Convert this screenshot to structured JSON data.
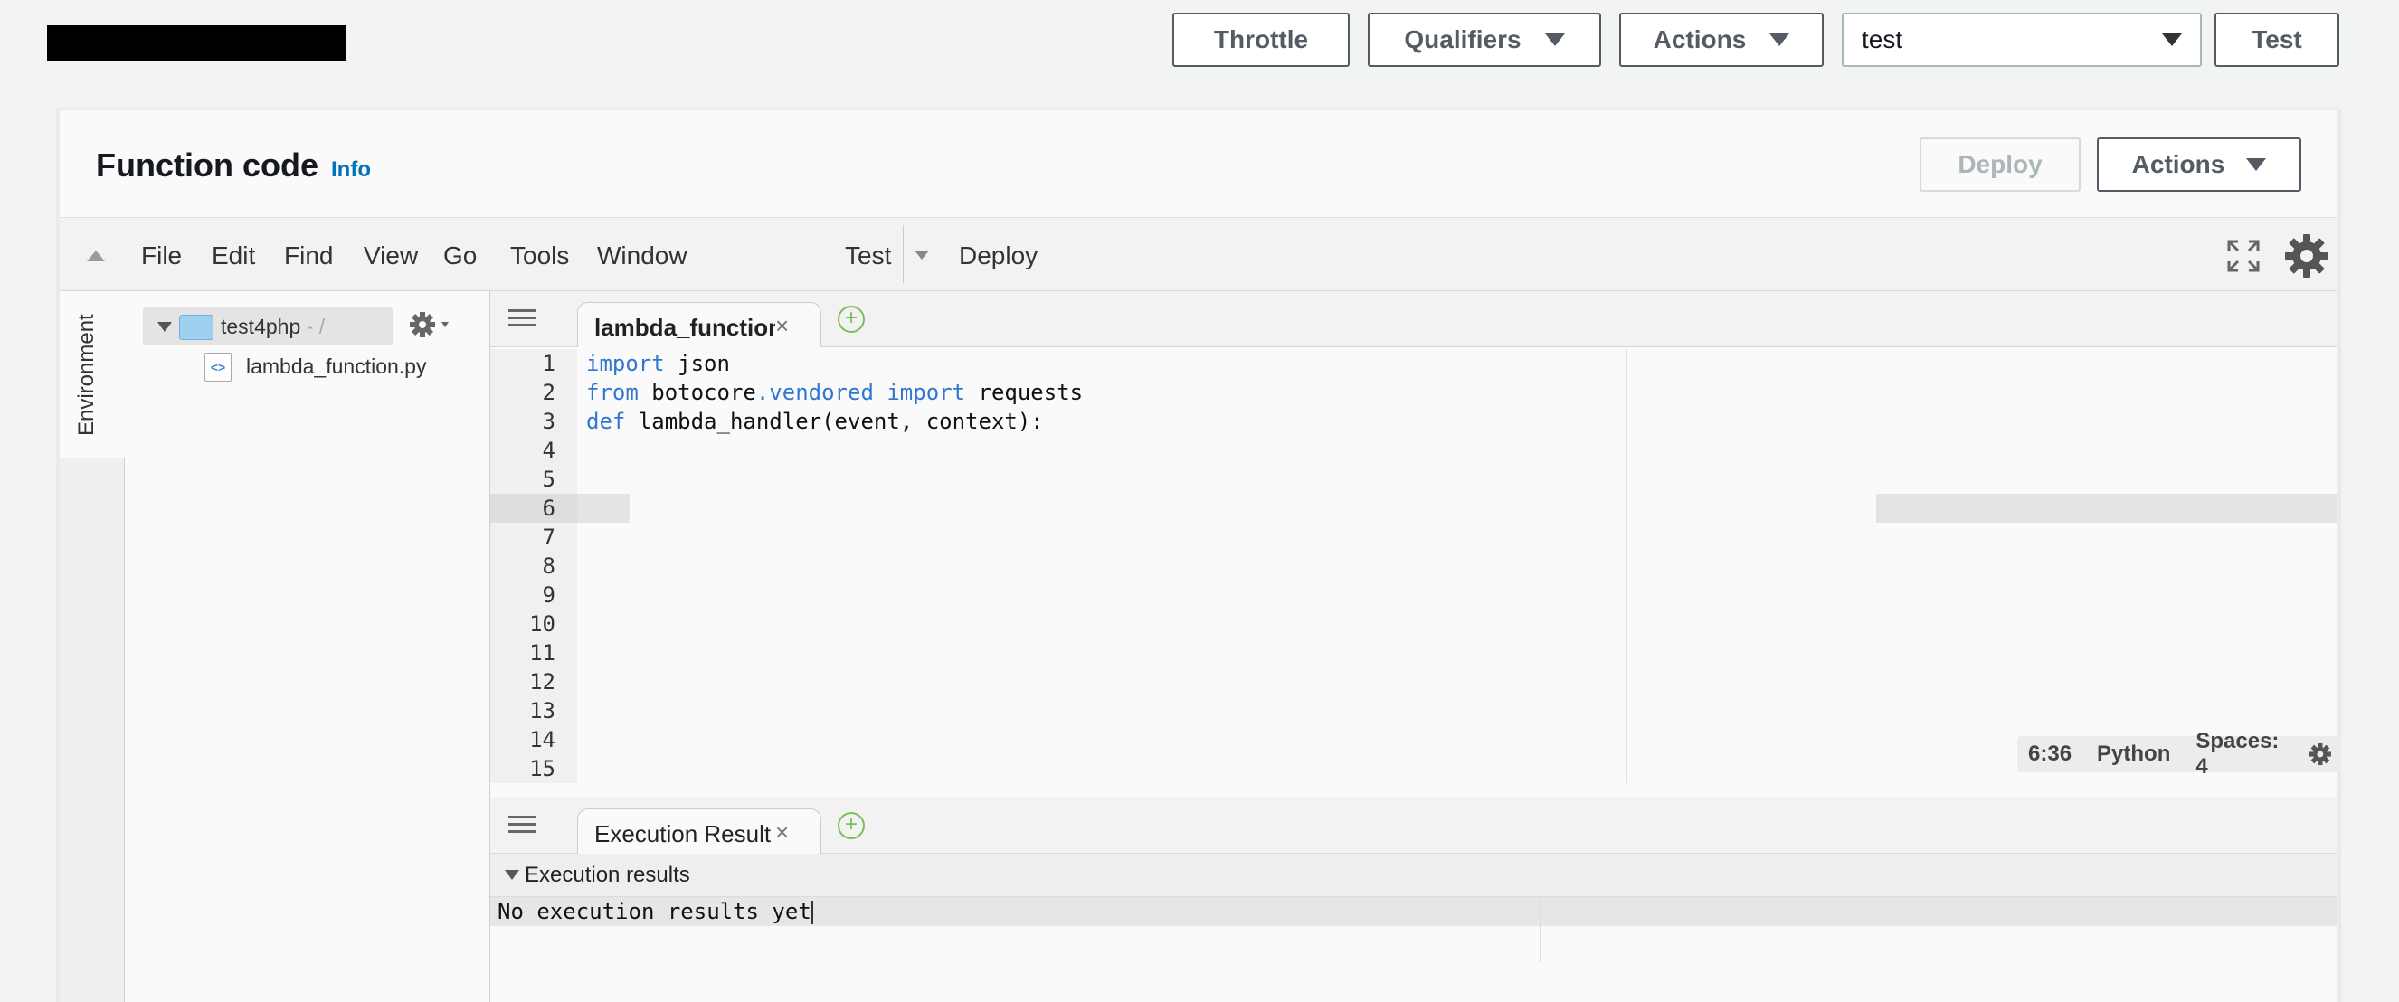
{
  "topbar": {
    "throttle_label": "Throttle",
    "qualifiers_label": "Qualifiers",
    "actions_label": "Actions",
    "test_event_selected": "test",
    "test_label": "Test"
  },
  "function_code": {
    "title": "Function code",
    "info_label": "Info",
    "deploy_label": "Deploy",
    "actions_label": "Actions"
  },
  "ide_menu": {
    "items": [
      "File",
      "Edit",
      "Find",
      "View",
      "Go",
      "Tools",
      "Window"
    ],
    "test_label": "Test",
    "deploy_label": "Deploy"
  },
  "environment": {
    "tab_label": "Environment",
    "root_name": "test4php",
    "root_path": " - /",
    "file_name": "lambda_function.py"
  },
  "editor": {
    "tab_label": "lambda_function",
    "line_numbers": [
      "1",
      "2",
      "3",
      "4",
      "5",
      "6",
      "7",
      "8",
      "9",
      "10",
      "11",
      "12",
      "13",
      "14",
      "15"
    ],
    "active_line": 6,
    "status": {
      "cursor": "6:36",
      "language": "Python",
      "spaces": "Spaces: 4"
    }
  },
  "execution": {
    "tab_label": "Execution Result",
    "section_title": "Execution results",
    "output": "No execution results yet"
  },
  "colors": {
    "keyword": "#3277cf",
    "info_link": "#0073bb",
    "add_tab": "#7bbf5a"
  }
}
